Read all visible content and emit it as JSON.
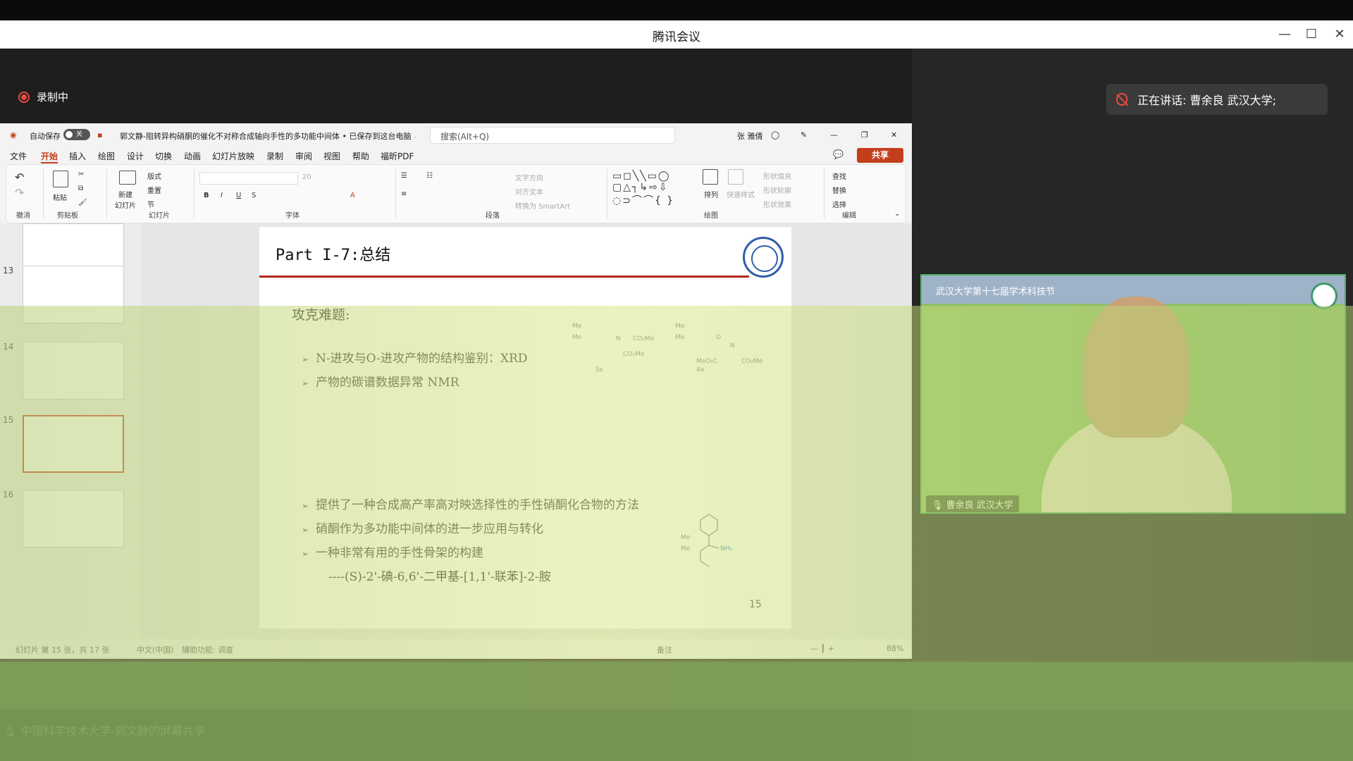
{
  "window": {
    "title": "腾讯会议",
    "minimize": "—",
    "maximize": "☐",
    "close": "✕"
  },
  "recording": {
    "label": "录制中"
  },
  "ppt": {
    "autosave": "自动保存",
    "toggle": "关",
    "doc_title": "郭文静-阻转异构硝酮的催化不对称合成轴向手性的多功能中间体 • 已保存到这台电脑 ⌄",
    "search_placeholder": "搜索(Alt+Q)",
    "user": "张 雅倩",
    "menu": [
      "文件",
      "开始",
      "插入",
      "绘图",
      "设计",
      "切换",
      "动画",
      "幻灯片放映",
      "录制",
      "审阅",
      "视图",
      "帮助",
      "福昕PDF"
    ],
    "share": "共享",
    "ribbon_groups": [
      "撤消",
      "剪贴板",
      "幻灯片",
      "字体",
      "段落",
      "绘图",
      "编辑"
    ],
    "ribbon_items": {
      "paste": "粘贴",
      "new_slide": "新建\n幻灯片",
      "layout": "版式",
      "reset": "重置",
      "section": "节",
      "text_dir": "文字方向",
      "align_text": "对齐文本",
      "smartart": "转换为 SmartArt",
      "arrange": "排列",
      "quick_styles": "快速样式",
      "shape_fill": "形状填充",
      "shape_outline": "形状轮廓",
      "shape_effect": "形状效果",
      "find": "查找",
      "replace": "替换",
      "select": "选择",
      "font_size": "20"
    },
    "thumb_numbers": [
      "13",
      "14",
      "15",
      "16"
    ],
    "status": {
      "slide_count": "幻灯片 第 15 张，共 17 张",
      "lang": "中文(中国)",
      "accessibility": "辅助功能: 调查",
      "notes": "备注",
      "zoom": "88%"
    }
  },
  "slide": {
    "title": "Part I-7:总结",
    "subtitle": "攻克难题:",
    "bullets_top": [
      "N-进攻与O-进攻产物的结构鉴别：XRD",
      "产物的碳谱数据异常 NMR"
    ],
    "bullets_bottom": [
      "提供了一种合成高产率高对映选择性的手性硝酮化合物的方法",
      "硝酮作为多功能中间体的进一步应用与转化",
      "一种非常有用的手性骨架的构建"
    ],
    "compound": "----(S)-2'-碘-6,6'-二甲基-[1,1'-联苯]-2-胺",
    "page_number": "15",
    "chem_labels": [
      "Me",
      "Me",
      "N",
      "CO₂Me",
      "CO₂Me",
      "Me",
      "Me",
      "O",
      "N",
      "MeO₂C",
      "CO₂Me",
      "3a",
      "4a",
      "Me",
      "Me",
      "NH₂"
    ]
  },
  "meeting": {
    "speaking_label": "正在讲话: 曹余良 武汉大学;",
    "video_banner": "武汉大学第十七届学术科技节",
    "video_name": "曹余良 武汉大学",
    "share_label": "中国科学技术大学-郭文静的屏幕共享"
  }
}
